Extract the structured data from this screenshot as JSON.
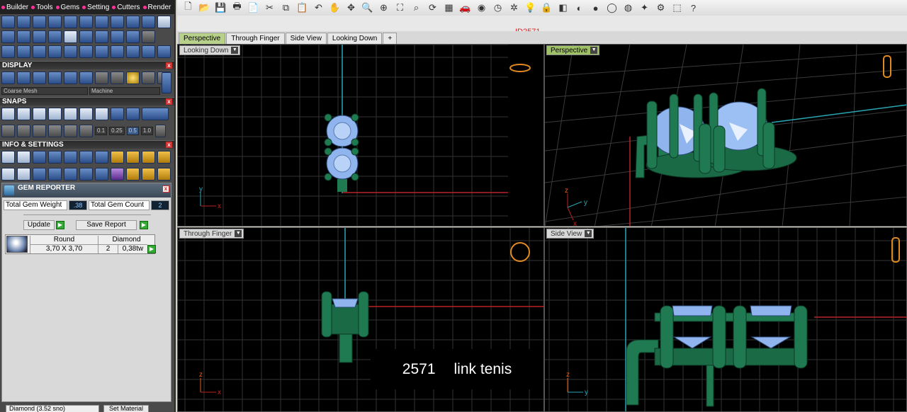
{
  "menu": {
    "tabs": [
      "Builder",
      "Tools",
      "Gems",
      "Setting",
      "Cutters",
      "Render"
    ]
  },
  "display": {
    "title": "DISPLAY",
    "mesh_combo": "Coarse Mesh",
    "render_combo": "Machine"
  },
  "snaps": {
    "title": "SNAPS",
    "values": [
      "0.1",
      "0.25",
      "0.5",
      "1.0"
    ]
  },
  "info": {
    "title": "INFO & SETTINGS"
  },
  "gem_reporter": {
    "title": "GEM REPORTER",
    "weight_label": "Total Gem Weight",
    "weight_value": ".38",
    "count_label": "Total Gem Count",
    "count_value": "2",
    "update_label": "Update",
    "save_label": "Save Report",
    "table": {
      "shape_header": "Round",
      "material_header": "Diamond",
      "size": "3,70 X 3,70",
      "qty": "2",
      "weight": "0,38tw"
    },
    "bottom_combo": "Diamond (3.52 sno)",
    "bottom_button": "Set Material"
  },
  "toolbar": {
    "icons": [
      "new-icon",
      "open-icon",
      "save-icon",
      "print-icon",
      "copy-doc-icon",
      "cut-icon",
      "copy-icon",
      "paste-icon",
      "undo-icon",
      "pan-icon",
      "move-icon",
      "zoom-icon",
      "zoom-window-icon",
      "zoom-extents-icon",
      "zoom-selected-icon",
      "rotate-view-icon",
      "grid-icon",
      "car-icon",
      "camera-icon",
      "history-icon",
      "snap-icon",
      "light-icon",
      "lock-icon",
      "layers-icon",
      "color-icon",
      "shade-icon",
      "sphere-icon",
      "globe-icon",
      "wand-icon",
      "gear-icon",
      "selection-icon",
      "help-icon"
    ]
  },
  "document": {
    "id": "ID2571"
  },
  "view_tabs": [
    "Perspective",
    "Through Finger",
    "Side View",
    "Looking Down",
    "+"
  ],
  "viewports": {
    "top_left": {
      "label": "Looking Down",
      "axis_a": "y",
      "axis_b": "x"
    },
    "top_right": {
      "label": "Perspective",
      "axis_a": "z",
      "axis_b": "y",
      "axis_c": "x"
    },
    "bottom_left": {
      "label": "Through Finger",
      "axis_a": "z",
      "axis_b": "x"
    },
    "bottom_right": {
      "label": "Side View",
      "axis_a": "z",
      "axis_b": "y"
    }
  },
  "overlay": {
    "code": "2571",
    "name": "link tenis"
  },
  "colors": {
    "metal": "#1f7a52",
    "gem": "#8fb4ee",
    "grid": "#3a3a3a",
    "axis_red": "#b22",
    "axis_cyan": "#2aa6b3"
  }
}
